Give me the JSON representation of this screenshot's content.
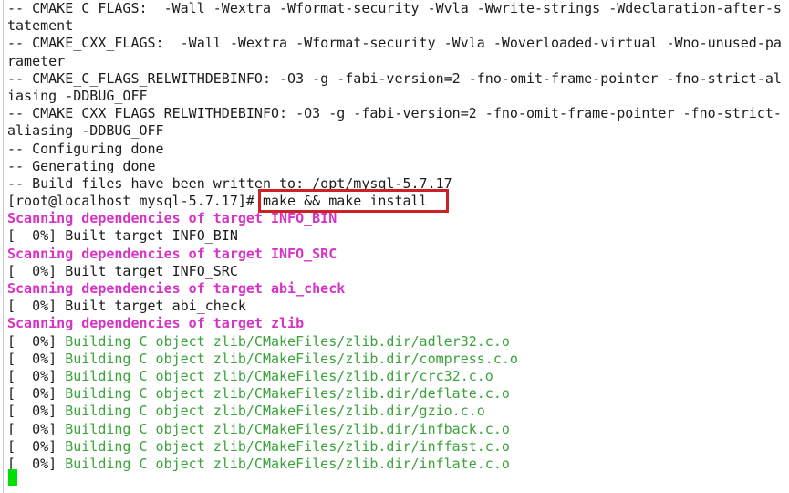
{
  "terminal": {
    "background_color": "#ffffff",
    "default_text_color": "#1c1c1c",
    "magenta_color": "#d633c6",
    "green_color": "#3aa33a",
    "highlight_box_color": "#cc2127",
    "cursor_color": "#00e000",
    "prompt": "[root@localhost mysql-5.7.17]#",
    "typed_command": "make && make install",
    "lines": [
      {
        "id": 0,
        "color": "default",
        "text": "-- CMAKE_C_FLAGS:  -Wall -Wextra -Wformat-security -Wvla -Wwrite-strings -Wdeclaration-after-s"
      },
      {
        "id": 1,
        "color": "default",
        "text": "tatement"
      },
      {
        "id": 2,
        "color": "default",
        "text": "-- CMAKE_CXX_FLAGS:  -Wall -Wextra -Wformat-security -Wvla -Woverloaded-virtual -Wno-unused-pa"
      },
      {
        "id": 3,
        "color": "default",
        "text": "rameter"
      },
      {
        "id": 4,
        "color": "default",
        "text": "-- CMAKE_C_FLAGS_RELWITHDEBINFO: -O3 -g -fabi-version=2 -fno-omit-frame-pointer -fno-strict-al"
      },
      {
        "id": 5,
        "color": "default",
        "text": "iasing -DDBUG_OFF"
      },
      {
        "id": 6,
        "color": "default",
        "text": "-- CMAKE_CXX_FLAGS_RELWITHDEBINFO: -O3 -g -fabi-version=2 -fno-omit-frame-pointer -fno-strict-"
      },
      {
        "id": 7,
        "color": "default",
        "text": "aliasing -DDBUG_OFF"
      },
      {
        "id": 8,
        "color": "default",
        "text": "-- Configuring done"
      },
      {
        "id": 9,
        "color": "default",
        "text": "-- Generating done"
      },
      {
        "id": 10,
        "color": "default",
        "text": "-- Build files have been written to: /opt/mysql-5.7.17"
      },
      {
        "id": 11,
        "color": "default",
        "text": "[root@localhost mysql-5.7.17]# make && make install"
      },
      {
        "id": 12,
        "color": "magenta",
        "text": "Scanning dependencies of target INFO_BIN"
      },
      {
        "id": 13,
        "color": "default",
        "text": "[  0%] Built target INFO_BIN"
      },
      {
        "id": 14,
        "color": "magenta",
        "text": "Scanning dependencies of target INFO_SRC"
      },
      {
        "id": 15,
        "color": "default",
        "text": "[  0%] Built target INFO_SRC"
      },
      {
        "id": 16,
        "color": "magenta",
        "text": "Scanning dependencies of target abi_check"
      },
      {
        "id": 17,
        "color": "default",
        "text": "[  0%] Built target abi_check"
      },
      {
        "id": 18,
        "color": "magenta",
        "text": "Scanning dependencies of target zlib"
      },
      {
        "id": 19,
        "color": "split",
        "prefix": "[  0%] ",
        "suffix": "Building C object zlib/CMakeFiles/zlib.dir/adler32.c.o"
      },
      {
        "id": 20,
        "color": "split",
        "prefix": "[  0%] ",
        "suffix": "Building C object zlib/CMakeFiles/zlib.dir/compress.c.o"
      },
      {
        "id": 21,
        "color": "split",
        "prefix": "[  0%] ",
        "suffix": "Building C object zlib/CMakeFiles/zlib.dir/crc32.c.o"
      },
      {
        "id": 22,
        "color": "split",
        "prefix": "[  0%] ",
        "suffix": "Building C object zlib/CMakeFiles/zlib.dir/deflate.c.o"
      },
      {
        "id": 23,
        "color": "split",
        "prefix": "[  0%] ",
        "suffix": "Building C object zlib/CMakeFiles/zlib.dir/gzio.c.o"
      },
      {
        "id": 24,
        "color": "split",
        "prefix": "[  0%] ",
        "suffix": "Building C object zlib/CMakeFiles/zlib.dir/infback.c.o"
      },
      {
        "id": 25,
        "color": "split",
        "prefix": "[  0%] ",
        "suffix": "Building C object zlib/CMakeFiles/zlib.dir/inffast.c.o"
      },
      {
        "id": 26,
        "color": "split",
        "prefix": "[  0%] ",
        "suffix": "Building C object zlib/CMakeFiles/zlib.dir/inflate.c.o"
      }
    ]
  }
}
